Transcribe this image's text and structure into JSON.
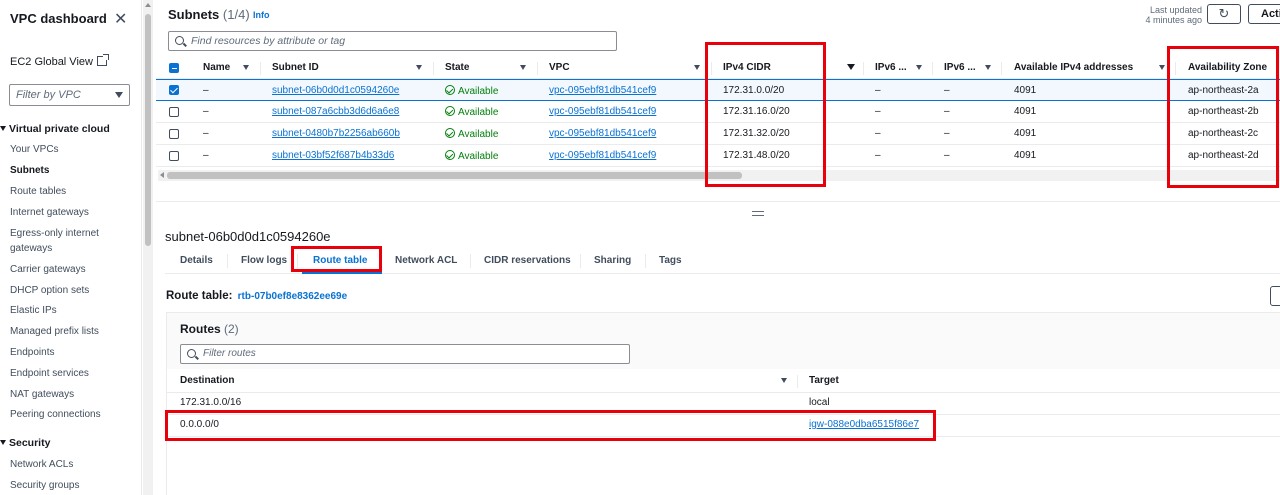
{
  "sidebar": {
    "title": "VPC dashboard",
    "ec2_global_view": "EC2 Global View",
    "filter_placeholder": "Filter by VPC",
    "section_vpc": "Virtual private cloud",
    "items": [
      "Your VPCs",
      "Subnets",
      "Route tables",
      "Internet gateways",
      "Egress-only internet gateways",
      "Carrier gateways",
      "DHCP option sets",
      "Elastic IPs",
      "Managed prefix lists",
      "Endpoints",
      "Endpoint services",
      "NAT gateways",
      "Peering connections"
    ],
    "active_item": "Subnets",
    "section_security": "Security",
    "security_items": [
      "Network ACLs",
      "Security groups"
    ]
  },
  "subnets": {
    "title": "Subnets",
    "count": "(1/4)",
    "info": "Info",
    "last_updated": "Last updated",
    "updated_ago": "4 minutes ago",
    "actions_label": "Acti",
    "search_placeholder": "Find resources by attribute or tag",
    "columns": [
      "Name",
      "Subnet ID",
      "State",
      "VPC",
      "IPv4 CIDR",
      "IPv6 ...",
      "IPv6 ...",
      "Available IPv4 addresses",
      "Availability Zone"
    ],
    "rows": [
      {
        "selected": true,
        "name": "–",
        "subnet_id": "subnet-06b0d0d1c0594260e",
        "state": "Available",
        "vpc": "vpc-095ebf81db541cef9",
        "ipv4": "172.31.0.0/20",
        "ipv6a": "–",
        "ipv6b": "–",
        "avail": "4091",
        "az": "ap-northeast-2a"
      },
      {
        "selected": false,
        "name": "–",
        "subnet_id": "subnet-087a6cbb3d6d6a6e8",
        "state": "Available",
        "vpc": "vpc-095ebf81db541cef9",
        "ipv4": "172.31.16.0/20",
        "ipv6a": "–",
        "ipv6b": "–",
        "avail": "4091",
        "az": "ap-northeast-2b"
      },
      {
        "selected": false,
        "name": "–",
        "subnet_id": "subnet-0480b7b2256ab660b",
        "state": "Available",
        "vpc": "vpc-095ebf81db541cef9",
        "ipv4": "172.31.32.0/20",
        "ipv6a": "–",
        "ipv6b": "–",
        "avail": "4091",
        "az": "ap-northeast-2c"
      },
      {
        "selected": false,
        "name": "–",
        "subnet_id": "subnet-03bf52f687b4b33d6",
        "state": "Available",
        "vpc": "vpc-095ebf81db541cef9",
        "ipv4": "172.31.48.0/20",
        "ipv6a": "–",
        "ipv6b": "–",
        "avail": "4091",
        "az": "ap-northeast-2d"
      }
    ]
  },
  "detail": {
    "title": "subnet-06b0d0d1c0594260e",
    "tabs": [
      "Details",
      "Flow logs",
      "Route table",
      "Network ACL",
      "CIDR reservations",
      "Sharing",
      "Tags"
    ],
    "active_tab": "Route table",
    "route_table_label": "Route table:",
    "route_table_id": "rtb-07b0ef8e8362ee69e"
  },
  "routes": {
    "title": "Routes",
    "count": "(2)",
    "search_placeholder": "Filter routes",
    "col_destination": "Destination",
    "col_target": "Target",
    "rows": [
      {
        "destination": "172.31.0.0/16",
        "target": "local",
        "target_link": false
      },
      {
        "destination": "0.0.0.0/0",
        "target": "igw-088e0dba6515f86e7",
        "target_link": true
      }
    ]
  },
  "colors": {
    "accent": "#0972d3",
    "success": "#037f0c",
    "annotation": "#e8000b"
  }
}
